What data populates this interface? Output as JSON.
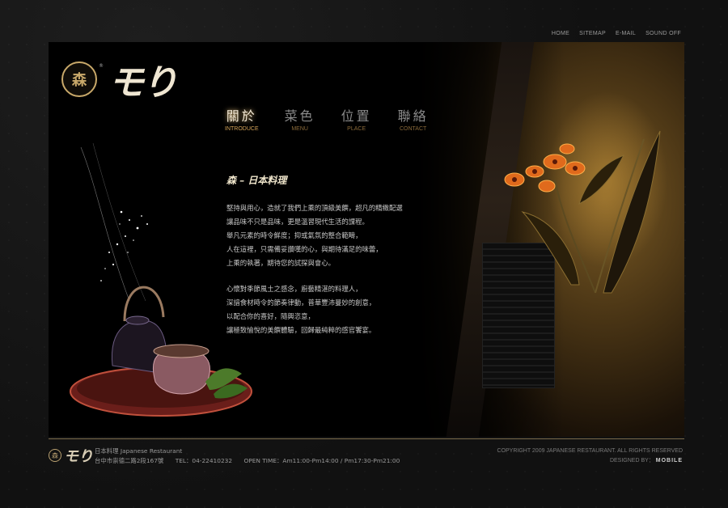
{
  "top_nav": [
    "HOME",
    "SITEMAP",
    "E-MAIL",
    "SOUND OFF"
  ],
  "logo": {
    "seal": "森",
    "reg": "®",
    "wordmark": "モり"
  },
  "main_nav": [
    {
      "zh": "關於",
      "en": "INTRODUCE",
      "active": true
    },
    {
      "zh": "菜色",
      "en": "MENU",
      "active": false
    },
    {
      "zh": "位置",
      "en": "PLACE",
      "active": false
    },
    {
      "zh": "聯絡",
      "en": "CONTACT",
      "active": false
    }
  ],
  "content": {
    "title": "森 – 日本料理",
    "paragraph1": [
      "堅持與用心，造就了我們上乘的頂級美饌，超凡的精緻配選",
      "讓品味不只是品味，更是溫習現代生活的課程。",
      "舉凡元素的時令鮮度；抑或氣氛的整合範疇，",
      "人在這裡，只需備妥讚嘆的心，與期待滿足的味蕾，",
      "上乘的執著，期待您的試探與會心。"
    ],
    "paragraph2": [
      "心懷對季節風土之感念，廚藝精湛的料理人，",
      "深諳食材時令的節奏律動，普華豐沛曼妙的創意，",
      "以配合你的喜好，隨興恣意，",
      "讓極致愉悅的美饌體驗，回歸最純粹的感官饗宴。"
    ]
  },
  "footer": {
    "seal": "森",
    "wordmark": "モり",
    "name": "日本料理 Japanese Restaurant",
    "address": "台中市崇德二路2段167號",
    "tel": "TEL：04-22410232",
    "hours": "OPEN TIME：Am11:00-Pm14:00 / Pm17:30-Pm21:00",
    "copyright": "COPYRIGHT 2009 JAPANESE RESTAURANT. ALL RIGHTS RESERVED",
    "designed_by": "DESIGNED BY：",
    "designer": "MOBILE"
  }
}
